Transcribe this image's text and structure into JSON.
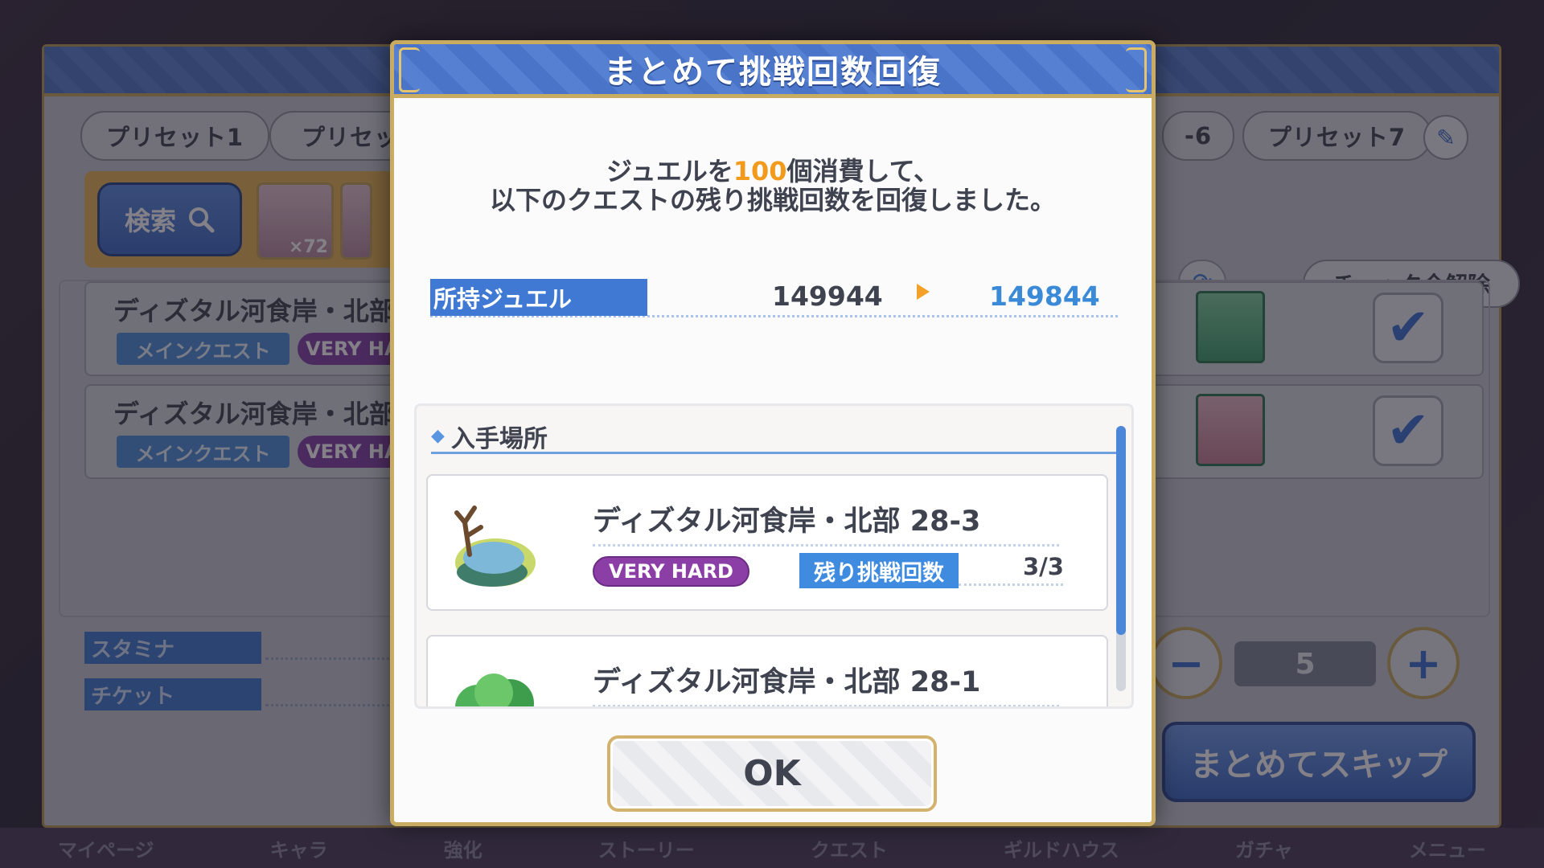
{
  "background": {
    "presets": [
      "プリセット1",
      "プリセッ",
      "-6",
      "プリセット7"
    ],
    "search_label": "検索",
    "avatar_badge": "×72",
    "uncheck_all_label": "チェック全解除",
    "quests": [
      {
        "title": "ディズタル河食岸・北部",
        "tag_main": "メインクエスト",
        "tag_difficulty": "VERY HA"
      },
      {
        "title": "ディズタル河食岸・北部",
        "tag_main": "メインクエスト",
        "tag_difficulty": "VERY HA"
      }
    ],
    "stamina_label": "スタミナ",
    "ticket_label": "チケット",
    "stepper_value": "5",
    "skip_label": "まとめてスキップ",
    "nav_items": [
      "マイページ",
      "キャラ",
      "強化",
      "ストーリー",
      "クエスト",
      "ギルドハウス",
      "ガチャ",
      "メニュー"
    ]
  },
  "dialog": {
    "title": "まとめて挑戦回数回復",
    "message_pre": "ジュエルを",
    "message_amount": "100",
    "message_post": "個消費して、",
    "message_line2": "以下のクエストの残り挑戦回数を回復しました。",
    "jewel_label": "所持ジュエル",
    "jewel_before": "149944",
    "jewel_after": "149844",
    "source_heading": "入手場所",
    "quests": [
      {
        "name": "ディズタル河食岸・北部 28-3",
        "difficulty": "VERY HARD",
        "remaining_label": "残り挑戦回数",
        "remaining": "3/3"
      },
      {
        "name": "ディズタル河食岸・北部 28-1"
      }
    ],
    "ok_label": "OK"
  },
  "colors": {
    "accent_blue": "#3f79d3",
    "jewel_highlight": "#f29a1c",
    "jewel_after": "#3a8ad8",
    "very_hard": "#8c3ea7",
    "frame_gold": "#c9ab62"
  },
  "icons": [
    "search-icon",
    "pencil-icon",
    "refresh-icon",
    "check-icon",
    "minus-icon",
    "plus-icon",
    "tree-island-icon",
    "bush-island-icon",
    "diamond-icon"
  ]
}
